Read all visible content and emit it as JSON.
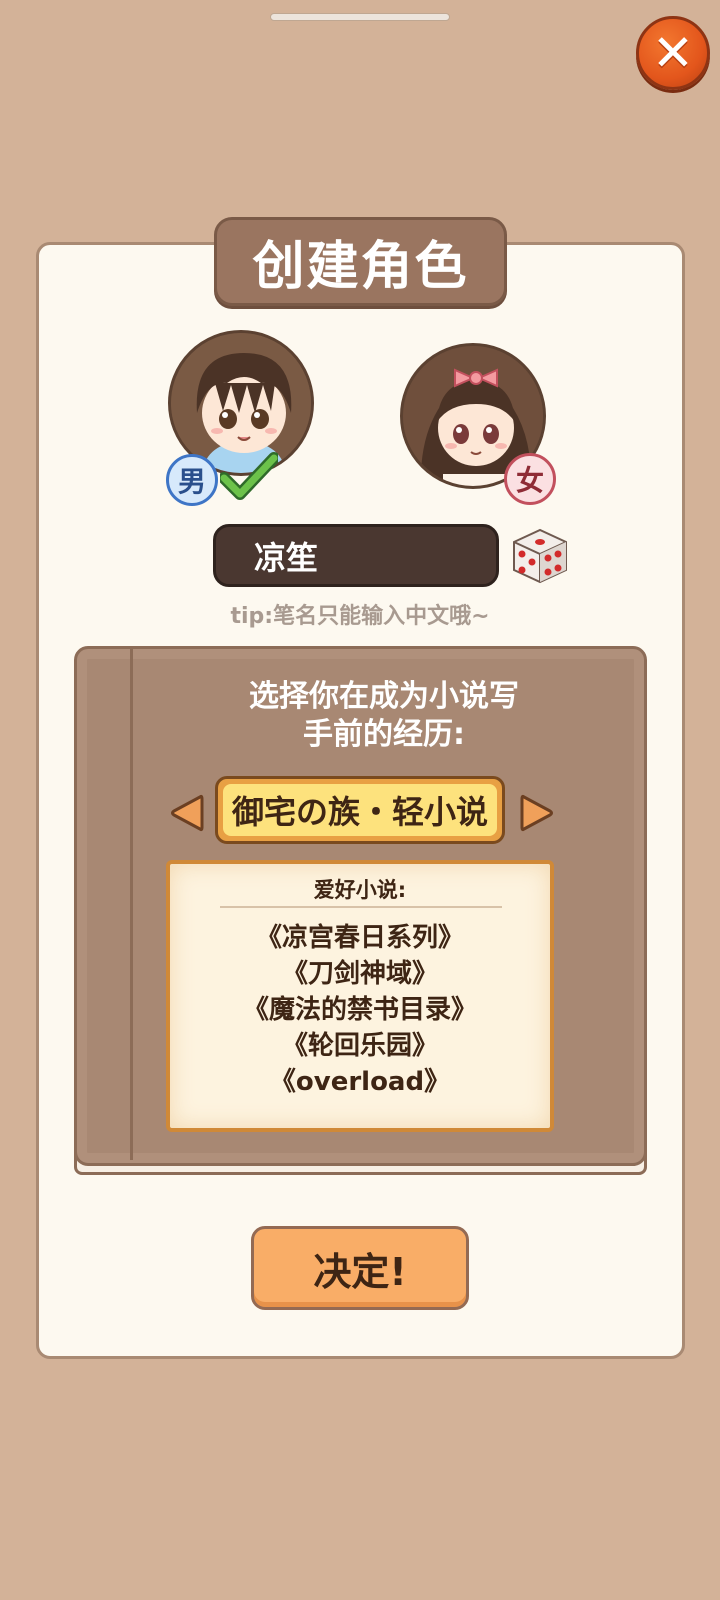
{
  "dialog": {
    "title": "创建角色",
    "close_label": "✕"
  },
  "character": {
    "male_badge": "男",
    "female_badge": "女",
    "selected_gender": "male",
    "name_value": "凉笙",
    "tip": "tip:笔名只能输入中文哦~"
  },
  "experience": {
    "heading_line1": "选择你在成为小说写",
    "heading_line2": "手前的经历:",
    "selected_option": "御宅の族・轻小说",
    "detail_label": "爱好小说:",
    "novels": [
      "《凉宫春日系列》",
      "《刀剑神域》",
      "《魔法的禁书目录》",
      "《轮回乐园》",
      "《overload》"
    ]
  },
  "confirm_label": "决定!",
  "colors": {
    "background": "#d3b298",
    "panel": "#fdf9f0",
    "title_plate": "#9a7560",
    "accent_orange": "#f9ad67",
    "close_red": "#e3561c"
  }
}
